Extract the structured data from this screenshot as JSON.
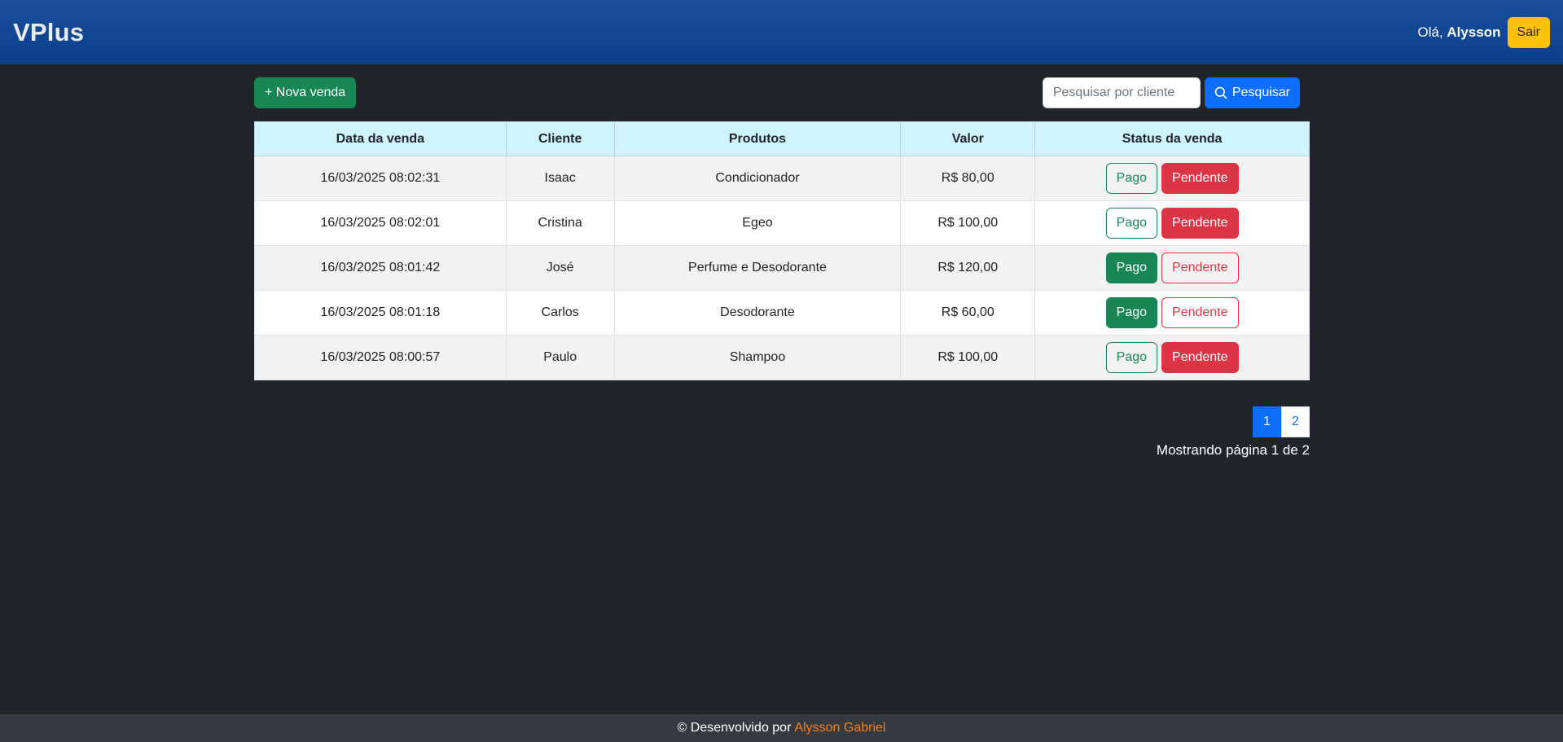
{
  "navbar": {
    "brand": "VPlus",
    "greeting_prefix": "Olá, ",
    "user_name": "Alysson",
    "logout_label": "Sair"
  },
  "toolbar": {
    "new_sale_label": "+ Nova venda",
    "search_placeholder": "Pesquisar por cliente",
    "search_label": "Pesquisar"
  },
  "table": {
    "headers": [
      "Data da venda",
      "Cliente",
      "Produtos",
      "Valor",
      "Status da venda"
    ],
    "status_labels": {
      "paid": "Pago",
      "pending": "Pendente"
    },
    "rows": [
      {
        "date": "16/03/2025 08:02:31",
        "client": "Isaac",
        "products": "Condicionador",
        "value": "R$ 80,00",
        "status": "pending"
      },
      {
        "date": "16/03/2025 08:02:01",
        "client": "Cristina",
        "products": "Egeo",
        "value": "R$ 100,00",
        "status": "pending"
      },
      {
        "date": "16/03/2025 08:01:42",
        "client": "José",
        "products": "Perfume e Desodorante",
        "value": "R$ 120,00",
        "status": "paid"
      },
      {
        "date": "16/03/2025 08:01:18",
        "client": "Carlos",
        "products": "Desodorante",
        "value": "R$ 60,00",
        "status": "paid"
      },
      {
        "date": "16/03/2025 08:00:57",
        "client": "Paulo",
        "products": "Shampoo",
        "value": "R$ 100,00",
        "status": "pending"
      }
    ]
  },
  "pagination": {
    "pages": [
      "1",
      "2"
    ],
    "current": "1",
    "info": "Mostrando página 1 de 2"
  },
  "footer": {
    "text": "© Desenvolvido por",
    "author": "Alysson Gabriel"
  },
  "colors": {
    "success": "#198754",
    "danger": "#dc3545",
    "primary": "#0d6efd",
    "warning": "#ffc107",
    "author_link": "#fd7e14"
  }
}
